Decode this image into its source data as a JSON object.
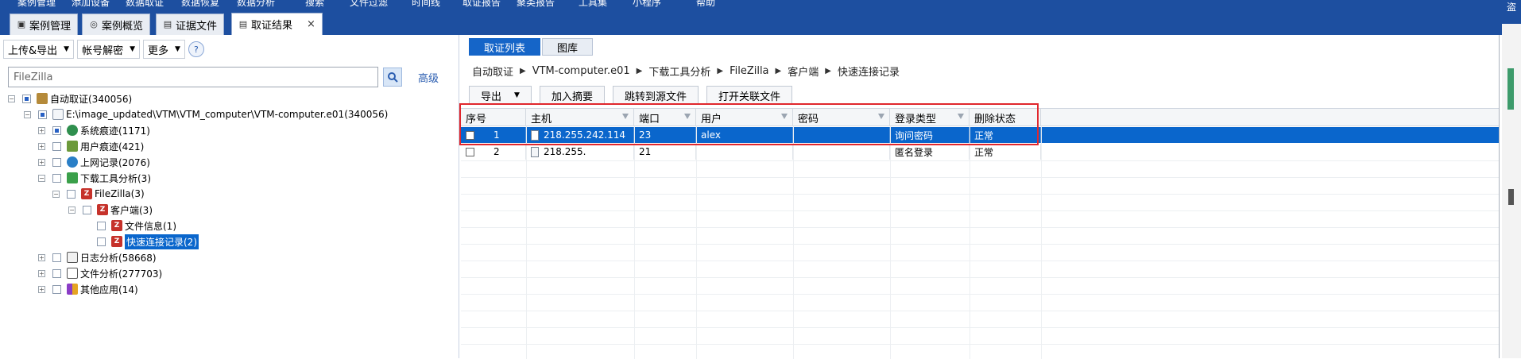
{
  "top_menu": [
    "案例管理",
    "添加设备",
    "数据取证",
    "数据恢复",
    "数据分析",
    "搜索",
    "文件过滤",
    "时间线",
    "取证报告",
    "聚类报告",
    "工具集",
    "小程序",
    "帮助"
  ],
  "top_right_char": "盗",
  "tabs": [
    {
      "label": "案例管理",
      "icon": "case-icon"
    },
    {
      "label": "案例概览",
      "icon": "overview-icon"
    },
    {
      "label": "证据文件",
      "icon": "evidence-icon"
    },
    {
      "label": "取证结果",
      "icon": "result-icon",
      "active": true
    }
  ],
  "left_toolbar": {
    "upload_export": "上传&导出",
    "account_decrypt": "帐号解密",
    "more": "更多",
    "help": "?"
  },
  "search": {
    "value": "FileZilla",
    "advanced": "高级"
  },
  "tree": [
    {
      "label": "自动取证(340056)",
      "icon": "auto-forensics-icon"
    },
    {
      "label": "E:\\image_updated\\VTM\\VTM_computer\\VTM-computer.e01(340056)",
      "icon": "image-file-icon"
    },
    {
      "label": "系统痕迹(1171)",
      "icon": "system-trace-icon"
    },
    {
      "label": "用户痕迹(421)",
      "icon": "user-trace-icon"
    },
    {
      "label": "上网记录(2076)",
      "icon": "web-history-icon"
    },
    {
      "label": "下载工具分析(3)",
      "icon": "download-tool-icon"
    },
    {
      "label": "FileZilla(3)",
      "icon": "filezilla-icon"
    },
    {
      "label": "客户端(3)",
      "icon": "client-icon"
    },
    {
      "label": "文件信息(1)",
      "icon": "file-info-icon"
    },
    {
      "label": "快速连接记录(2)",
      "icon": "quick-connect-icon",
      "selected": true
    },
    {
      "label": "日志分析(58668)",
      "icon": "log-analysis-icon"
    },
    {
      "label": "文件分析(277703)",
      "icon": "file-analysis-icon"
    },
    {
      "label": "其他应用(14)",
      "icon": "other-apps-icon"
    }
  ],
  "right_tabs": [
    "取证列表",
    "图库"
  ],
  "breadcrumb": [
    "自动取证",
    "VTM-computer.e01",
    "下载工具分析",
    "FileZilla",
    "客户端",
    "快速连接记录"
  ],
  "action_buttons": {
    "export": "导出",
    "add_summary": "加入摘要",
    "jump_source": "跳转到源文件",
    "open_related": "打开关联文件"
  },
  "table": {
    "columns": [
      "序号",
      "主机",
      "端口",
      "用户",
      "密码",
      "登录类型",
      "删除状态"
    ],
    "rows": [
      {
        "index": "1",
        "host": "218.255.242.114",
        "port": "23",
        "user": "alex",
        "password": "",
        "login_type": "询问密码",
        "delete_status": "正常",
        "selected": true
      },
      {
        "index": "2",
        "host": "218.255.",
        "port": "21",
        "user": "",
        "password": "",
        "login_type": "匿名登录",
        "delete_status": "正常",
        "selected": false
      }
    ]
  },
  "colors": {
    "brand": "#1d4fa0",
    "selection": "#0a66cc",
    "highlight_box": "#e0272d"
  }
}
